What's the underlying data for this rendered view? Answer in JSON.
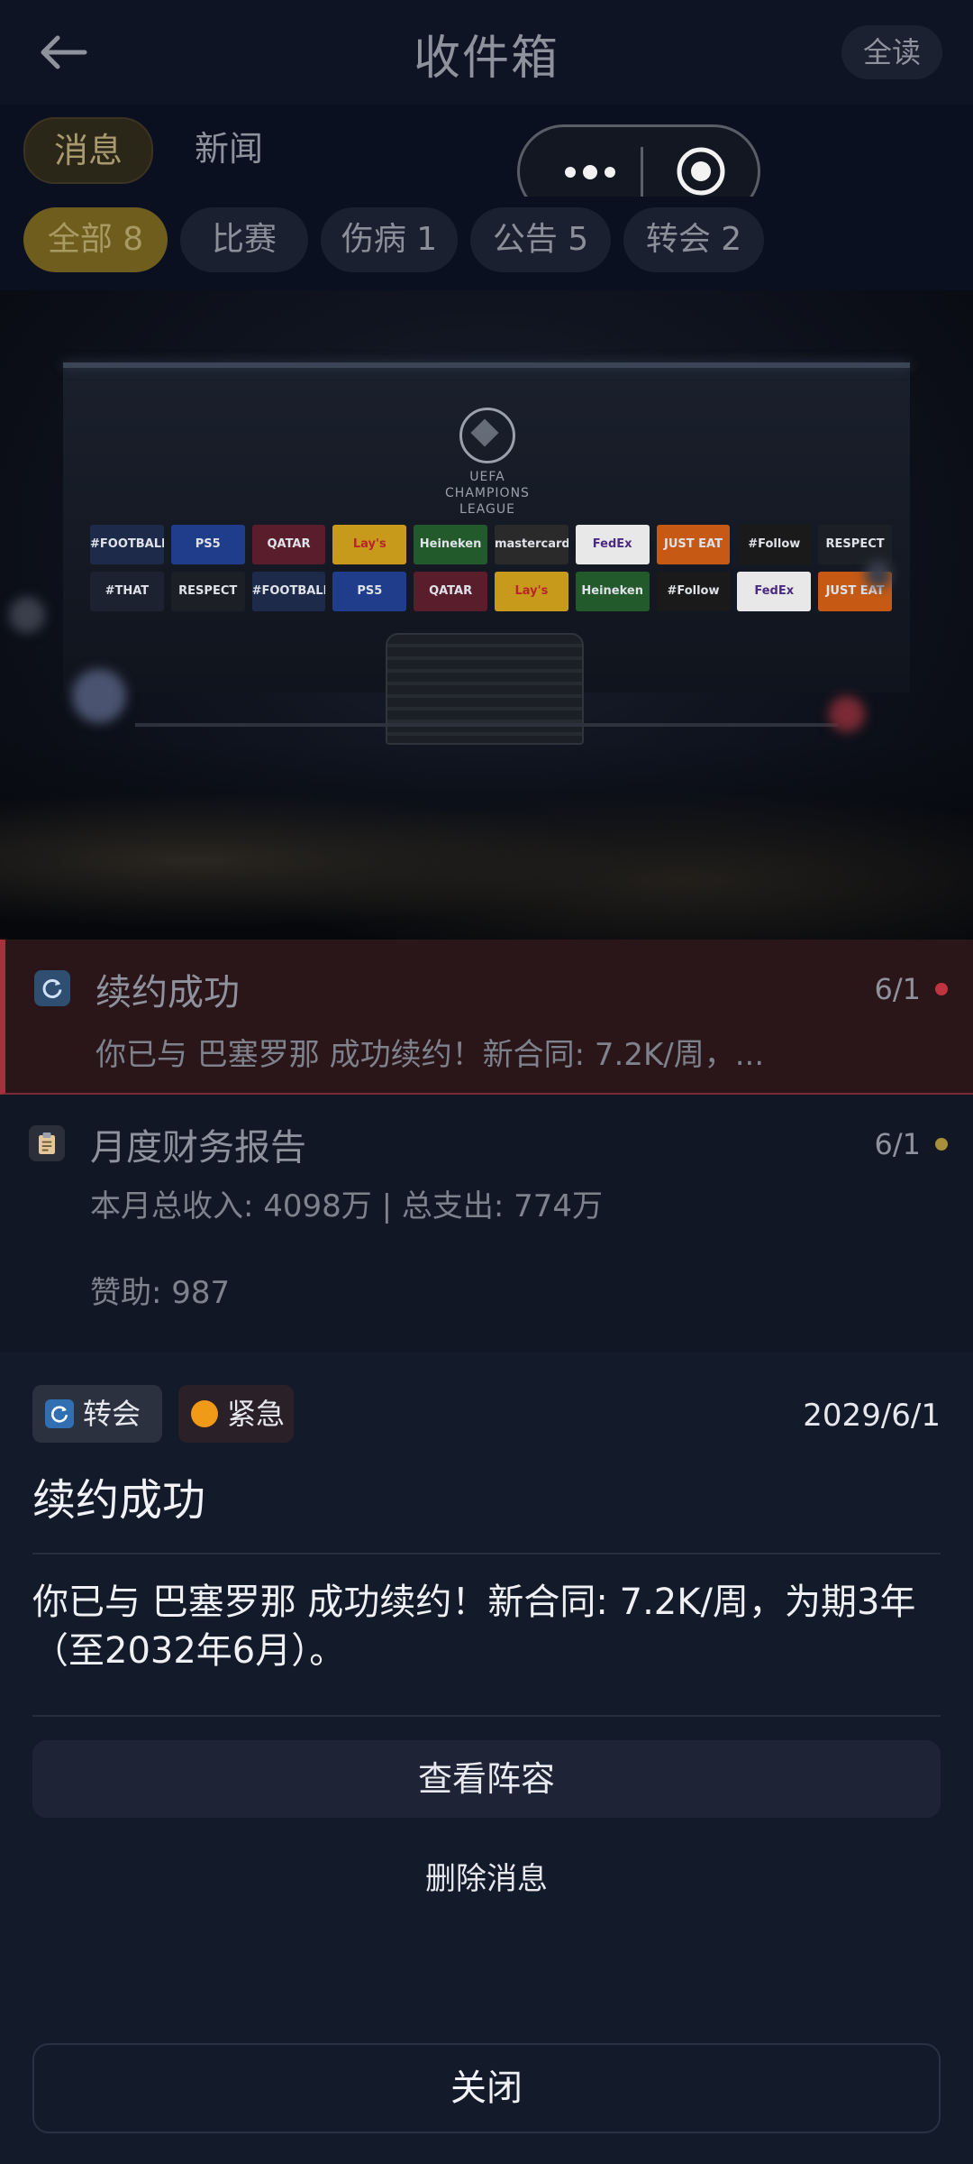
{
  "header": {
    "title": "收件箱",
    "read_all": "全读"
  },
  "tabs": [
    {
      "label": "消息",
      "active": true
    },
    {
      "label": "新闻",
      "active": false
    }
  ],
  "filters": [
    {
      "label": "全部 8",
      "active": true
    },
    {
      "label": "比赛",
      "active": false
    },
    {
      "label": "伤病 1",
      "active": false
    },
    {
      "label": "公告 5",
      "active": false
    },
    {
      "label": "转会 2",
      "active": false
    }
  ],
  "hero": {
    "logo_line1": "UEFA",
    "logo_line2": "CHAMPIONS",
    "logo_line3": "LEAGUE",
    "sponsors_row1": [
      "#FOOTBALL",
      "PS5",
      "QATAR",
      "Lay's",
      "Heineken",
      "mastercard",
      "FedEx",
      "JUST EAT",
      "#Follow",
      "RESPECT"
    ],
    "sponsors_row2": [
      "#THAT",
      "RESPECT",
      "#FOOTBALL",
      "PS5",
      "QATAR",
      "Lay's",
      "Heineken",
      "#Follow",
      "FedEx",
      "JUST EAT"
    ]
  },
  "messages": [
    {
      "title": "续约成功",
      "date": "6/1",
      "body": "你已与 巴塞罗那 成功续约！新合同: 7.2K/周，...",
      "dot_color": "#c0343f",
      "icon": "refresh-icon"
    },
    {
      "title": "月度财务报告",
      "date": "6/1",
      "body1": "本月总收入: 4098万 | 总支出: 774万",
      "body2": "赞助: 987",
      "dot_color": "#a8903a",
      "icon": "clipboard-icon"
    }
  ],
  "sheet": {
    "tag_transfer": "转会",
    "tag_urgent": "紧急",
    "date": "2029/6/1",
    "title": "续约成功",
    "body": "你已与 巴塞罗那 成功续约！新合同: 7.2K/周，为期3年（至2032年6月）。",
    "view_lineup": "查看阵容",
    "delete": "删除消息",
    "close": "关闭"
  }
}
